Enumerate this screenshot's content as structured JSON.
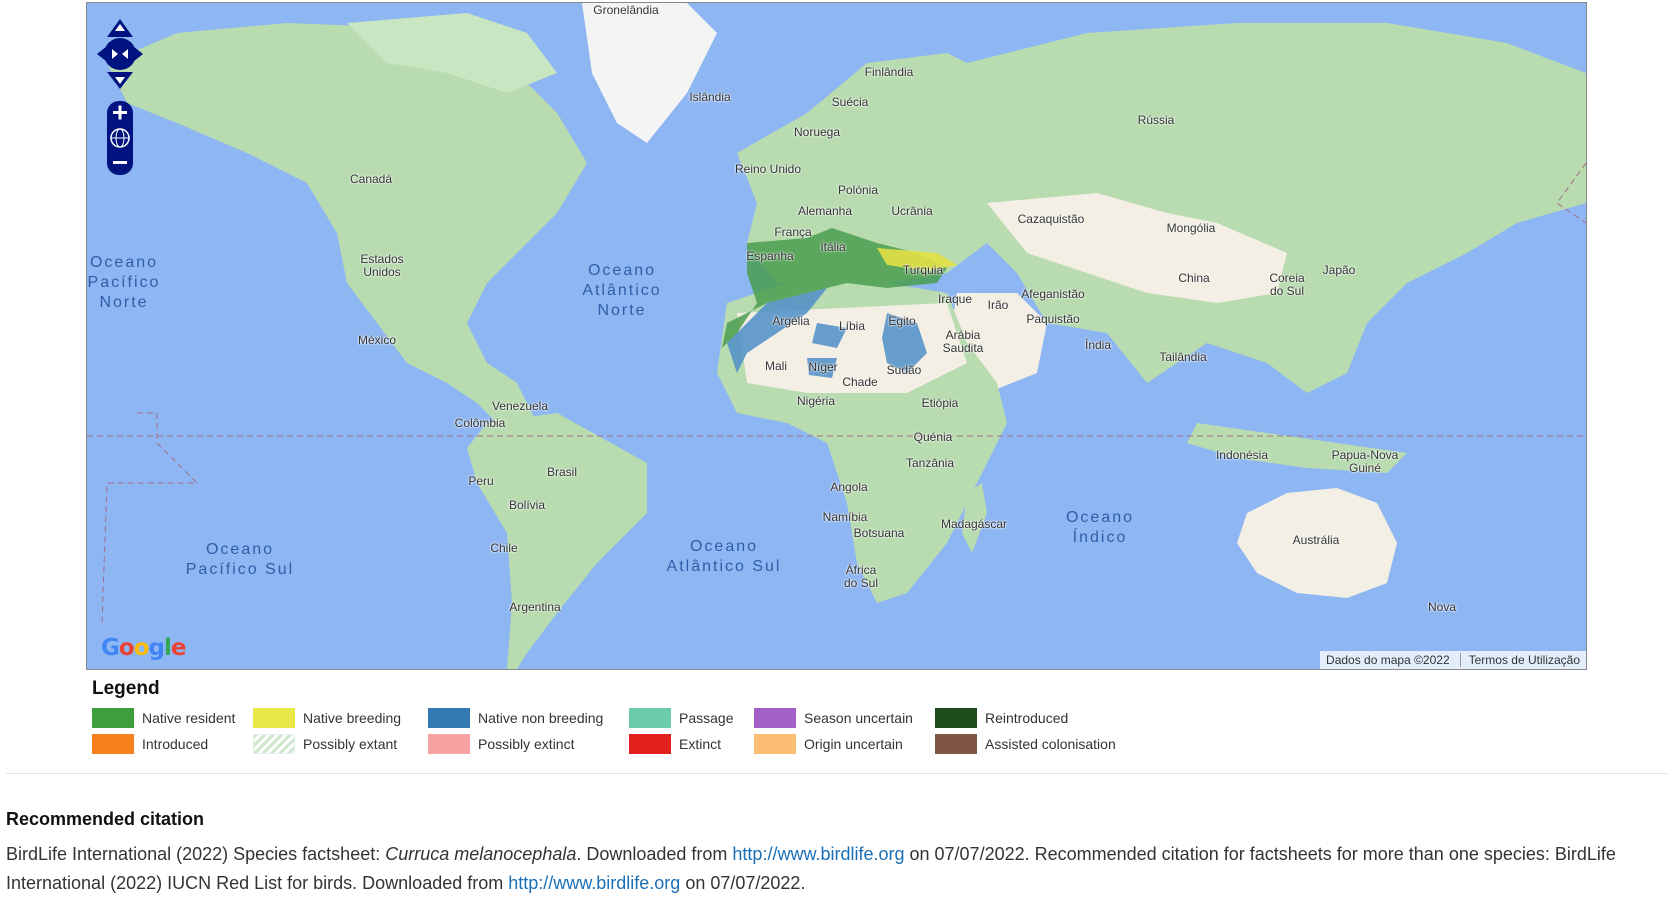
{
  "map": {
    "labels": {
      "gronelandia": "Gronelândia",
      "islandia": "Islândia",
      "finlandia": "Finlândia",
      "suecia": "Suécia",
      "noruega": "Noruega",
      "russia": "Rússia",
      "reino_unido": "Reino Unido",
      "polonia": "Polónia",
      "alemanha": "Alemanha",
      "ucrania": "Ucrânia",
      "franca": "França",
      "italia": "Itália",
      "espanha": "Espanha",
      "turquia": "Turquia",
      "cazaquistao": "Cazaquistão",
      "mongolia": "Mongólia",
      "china": "China",
      "coreia_do_sul": "Coreia do Sul",
      "japao": "Japão",
      "iraque": "Iraque",
      "irao": "Irão",
      "afeganistao": "Afeganistão",
      "paquistao": "Paquistão",
      "arabia_saudita": "Arábia Saudita",
      "india": "Índia",
      "tailandia": "Tailândia",
      "argelia": "Argélia",
      "libia": "Líbia",
      "egito": "Egito",
      "mali": "Mali",
      "niger": "Níger",
      "chade": "Chade",
      "sudao": "Sudão",
      "nigeria": "Nigéria",
      "etiopia": "Etiópia",
      "quenia": "Quénia",
      "tanzania": "Tanzânia",
      "angola": "Angola",
      "namibia": "Namíbia",
      "botsuana": "Botsuana",
      "madagascar": "Madagáscar",
      "africa_do_sul": "África do Sul",
      "indonesia": "Indonésia",
      "papua_nova_guine": "Papua-Nova Guiné",
      "australia": "Austrália",
      "nova": "Nova",
      "canada": "Canadá",
      "estados_unidos": "Estados Unidos",
      "mexico": "México",
      "venezuela": "Venezuela",
      "colombia": "Colômbia",
      "peru": "Peru",
      "brasil": "Brasil",
      "bolivia": "Bolívia",
      "chile": "Chile",
      "argentina": "Argentina"
    },
    "oceans": {
      "pacifico_norte": "Oceano Pacífico Norte",
      "atlantico_norte": "Oceano Atlântico Norte",
      "pacifico_sul": "Oceano Pacífico Sul",
      "atlantico_sul": "Oceano Atlântico Sul",
      "indico": "Oceano Índico"
    },
    "google_logo": "Google",
    "attribution": {
      "data": "Dados do mapa ©2022",
      "terms": "Termos de Utilização"
    },
    "colors": {
      "ocean": "#8eb6f2",
      "land": "#b8dbb0",
      "desert": "#f3efe4",
      "native_resident": "#4a9d4f",
      "native_non_breeding": "#4d8ec8",
      "native_breeding": "#e3e044"
    }
  },
  "legend": {
    "title": "Legend",
    "items": [
      {
        "label": "Native resident",
        "color": "#3c9e3c"
      },
      {
        "label": "Native breeding",
        "color": "#e8e84a"
      },
      {
        "label": "Native non breeding",
        "color": "#3478b4"
      },
      {
        "label": "Passage",
        "color": "#6dcbad"
      },
      {
        "label": "Season uncertain",
        "color": "#a45fc8"
      },
      {
        "label": "Reintroduced",
        "color": "#1d4d1a"
      },
      {
        "label": "Introduced",
        "color": "#f7801c"
      },
      {
        "label": "Possibly extant",
        "color": "hatch"
      },
      {
        "label": "Possibly extinct",
        "color": "#f7a3a3"
      },
      {
        "label": "Extinct",
        "color": "#e2201e"
      },
      {
        "label": "Origin uncertain",
        "color": "#fcbe72"
      },
      {
        "label": "Assisted colonisation",
        "color": "#7f5543"
      }
    ]
  },
  "citation": {
    "heading": "Recommended citation",
    "part1": "BirdLife International (2022) Species factsheet: ",
    "species": "Curruca melanocephala",
    "part2": ". Downloaded from ",
    "link1": "http://www.birdlife.org",
    "part3": " on 07/07/2022. Recommended citation for factsheets for more than one species: BirdLife International (2022) IUCN Red List for birds. Downloaded from ",
    "link2": "http://www.birdlife.org",
    "part4": " on 07/07/2022."
  }
}
